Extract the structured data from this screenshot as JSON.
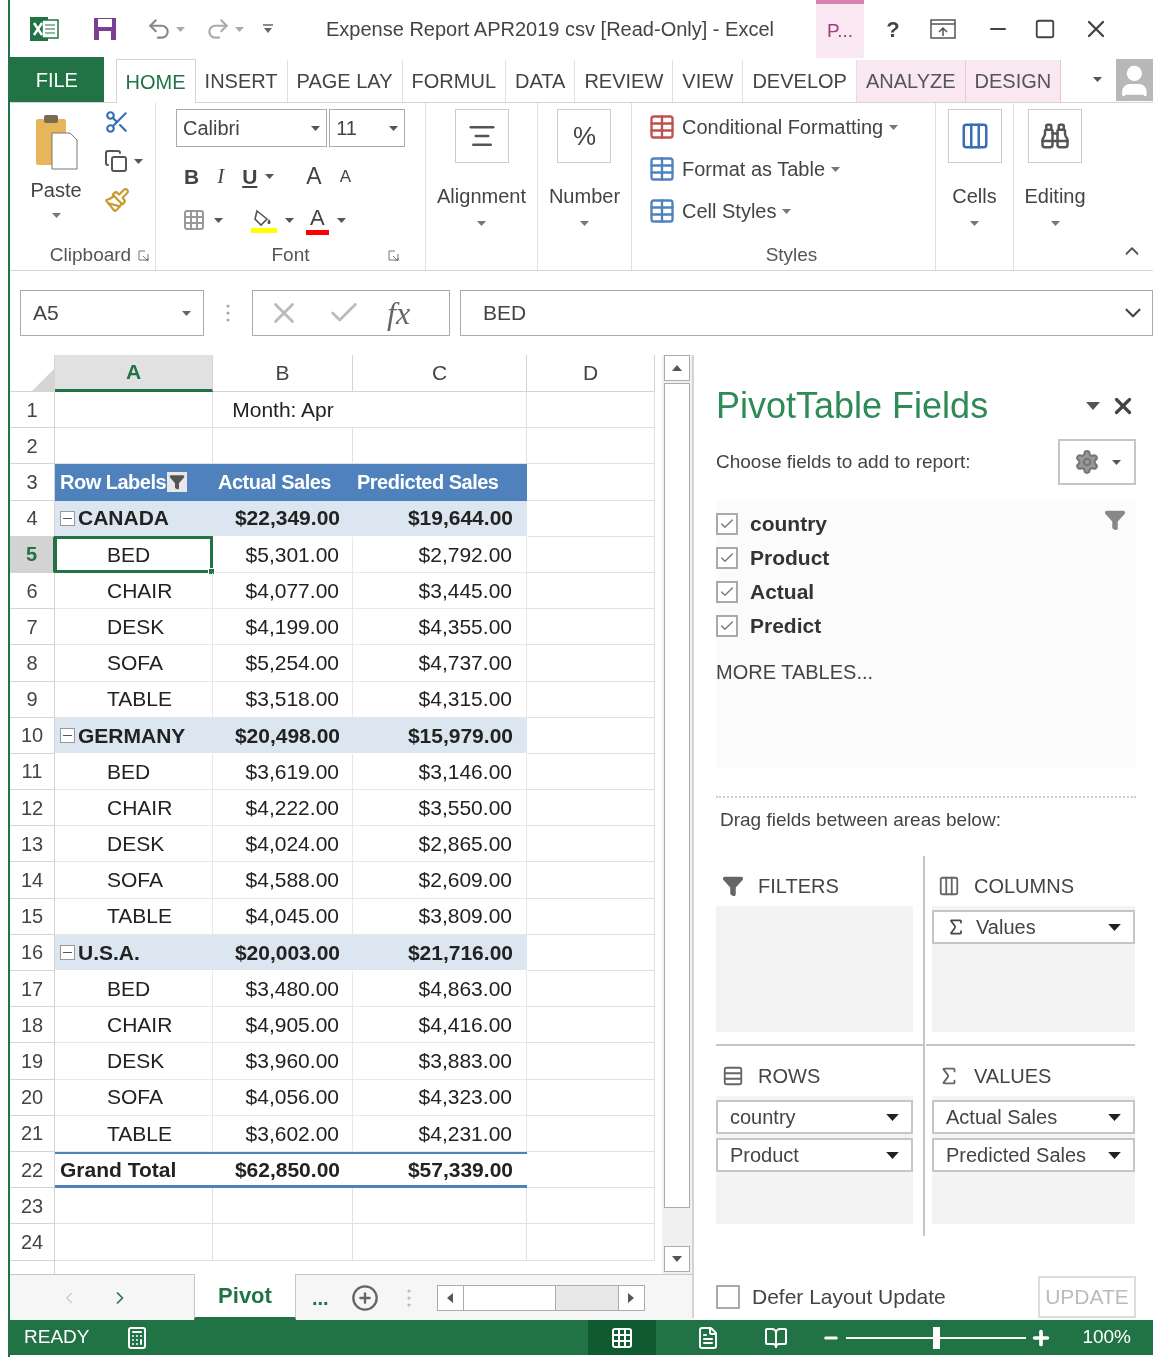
{
  "title_bar": {
    "title": "Expense Report APR2019 csv  [Read-Only] - Excel",
    "contextual_tab": "P...",
    "help": "?"
  },
  "ribbon_tabs": [
    {
      "label": "FILE",
      "kind": "file",
      "selected": false
    },
    {
      "label": "HOME",
      "kind": "tab",
      "selected": true
    },
    {
      "label": "INSERT",
      "kind": "tab",
      "selected": false
    },
    {
      "label": "PAGE LAY",
      "kind": "tab",
      "selected": false
    },
    {
      "label": "FORMUL",
      "kind": "tab",
      "selected": false
    },
    {
      "label": "DATA",
      "kind": "tab",
      "selected": false
    },
    {
      "label": "REVIEW",
      "kind": "tab",
      "selected": false
    },
    {
      "label": "VIEW",
      "kind": "tab",
      "selected": false
    },
    {
      "label": "DEVELOP",
      "kind": "tab",
      "selected": false
    },
    {
      "label": "ANALYZE",
      "kind": "contextual",
      "selected": false
    },
    {
      "label": "DESIGN",
      "kind": "contextual",
      "selected": false
    }
  ],
  "ribbon": {
    "clipboard": {
      "paste": "Paste",
      "label": "Clipboard"
    },
    "font": {
      "font_name": "Calibri",
      "font_size": "11",
      "bold": "B",
      "italic": "I",
      "underline": "U",
      "grow": "A",
      "shrink": "A",
      "font_color": "A",
      "label": "Font"
    },
    "alignment": {
      "label": "Alignment"
    },
    "number": {
      "icon_text": "%",
      "label": "Number"
    },
    "styles": {
      "items": [
        "Conditional Formatting",
        "Format as Table",
        "Cell Styles"
      ],
      "label": "Styles"
    },
    "cells": {
      "label": "Cells"
    },
    "editing": {
      "label": "Editing"
    }
  },
  "formula_bar": {
    "name_box": "A5",
    "fx": "fx",
    "value": "BED"
  },
  "grid": {
    "columns": [
      {
        "label": "A",
        "selected": true
      },
      {
        "label": "B",
        "selected": false
      },
      {
        "label": "C",
        "selected": false
      },
      {
        "label": "D",
        "selected": false
      }
    ],
    "rows": [
      {
        "header": "1",
        "kind": "title",
        "selected": false,
        "cells": [
          "",
          "Month: Apr"
        ]
      },
      {
        "header": "2",
        "kind": "blank",
        "selected": false,
        "cells": []
      },
      {
        "header": "3",
        "kind": "header",
        "selected": false,
        "cells": [
          "Row Labels",
          "Actual Sales",
          "Predicted Sales"
        ]
      },
      {
        "header": "4",
        "kind": "group",
        "selected": false,
        "expanded": true,
        "cells": [
          "CANADA",
          "$22,349.00",
          "$19,644.00"
        ]
      },
      {
        "header": "5",
        "kind": "item",
        "selected": true,
        "cells": [
          "BED",
          "$5,301.00",
          "$2,792.00"
        ]
      },
      {
        "header": "6",
        "kind": "item",
        "selected": false,
        "cells": [
          "CHAIR",
          "$4,077.00",
          "$3,445.00"
        ]
      },
      {
        "header": "7",
        "kind": "item",
        "selected": false,
        "cells": [
          "DESK",
          "$4,199.00",
          "$4,355.00"
        ]
      },
      {
        "header": "8",
        "kind": "item",
        "selected": false,
        "cells": [
          "SOFA",
          "$5,254.00",
          "$4,737.00"
        ]
      },
      {
        "header": "9",
        "kind": "item",
        "selected": false,
        "cells": [
          "TABLE",
          "$3,518.00",
          "$4,315.00"
        ]
      },
      {
        "header": "10",
        "kind": "group",
        "selected": false,
        "expanded": true,
        "cells": [
          "GERMANY",
          "$20,498.00",
          "$15,979.00"
        ]
      },
      {
        "header": "11",
        "kind": "item",
        "selected": false,
        "cells": [
          "BED",
          "$3,619.00",
          "$3,146.00"
        ]
      },
      {
        "header": "12",
        "kind": "item",
        "selected": false,
        "cells": [
          "CHAIR",
          "$4,222.00",
          "$3,550.00"
        ]
      },
      {
        "header": "13",
        "kind": "item",
        "selected": false,
        "cells": [
          "DESK",
          "$4,024.00",
          "$2,865.00"
        ]
      },
      {
        "header": "14",
        "kind": "item",
        "selected": false,
        "cells": [
          "SOFA",
          "$4,588.00",
          "$2,609.00"
        ]
      },
      {
        "header": "15",
        "kind": "item",
        "selected": false,
        "cells": [
          "TABLE",
          "$4,045.00",
          "$3,809.00"
        ]
      },
      {
        "header": "16",
        "kind": "group",
        "selected": false,
        "expanded": true,
        "cells": [
          "U.S.A.",
          "$20,003.00",
          "$21,716.00"
        ]
      },
      {
        "header": "17",
        "kind": "item",
        "selected": false,
        "cells": [
          "BED",
          "$3,480.00",
          "$4,863.00"
        ]
      },
      {
        "header": "18",
        "kind": "item",
        "selected": false,
        "cells": [
          "CHAIR",
          "$4,905.00",
          "$4,416.00"
        ]
      },
      {
        "header": "19",
        "kind": "item",
        "selected": false,
        "cells": [
          "DESK",
          "$3,960.00",
          "$3,883.00"
        ]
      },
      {
        "header": "20",
        "kind": "item",
        "selected": false,
        "cells": [
          "SOFA",
          "$4,056.00",
          "$4,323.00"
        ]
      },
      {
        "header": "21",
        "kind": "item",
        "selected": false,
        "cells": [
          "TABLE",
          "$3,602.00",
          "$4,231.00"
        ]
      },
      {
        "header": "22",
        "kind": "total",
        "selected": false,
        "cells": [
          "Grand Total",
          "$62,850.00",
          "$57,339.00"
        ]
      },
      {
        "header": "23",
        "kind": "blank",
        "selected": false,
        "cells": []
      },
      {
        "header": "24",
        "kind": "blank",
        "selected": false,
        "cells": []
      }
    ]
  },
  "sheet_tabs": {
    "tabs": [
      {
        "label": "Pivot",
        "selected": true
      }
    ],
    "more": "..."
  },
  "pivot_pane": {
    "title": "PivotTable Fields",
    "choose_label": "Choose fields to add to report:",
    "fields": [
      {
        "name": "country",
        "checked": true
      },
      {
        "name": "Product",
        "checked": true
      },
      {
        "name": "Actual",
        "checked": true
      },
      {
        "name": "Predict",
        "checked": true
      }
    ],
    "more_tables": "MORE TABLES...",
    "drag_label": "Drag fields between areas below:",
    "areas": [
      {
        "kind": "filters",
        "label": "FILTERS"
      },
      {
        "kind": "columns",
        "label": "COLUMNS",
        "items": [
          "Values"
        ]
      },
      {
        "kind": "rows",
        "label": "ROWS",
        "items": [
          "country",
          "Product"
        ]
      },
      {
        "kind": "values",
        "label": "VALUES",
        "items": [
          "Actual Sales",
          "Predicted Sales"
        ]
      }
    ],
    "defer": {
      "label": "Defer Layout Update",
      "checked": false
    },
    "update": {
      "label": "UPDATE",
      "disabled": true
    }
  },
  "status_bar": {
    "status": "READY",
    "zoom": "100%",
    "zoom_level": {
      "level": 0.5
    }
  }
}
